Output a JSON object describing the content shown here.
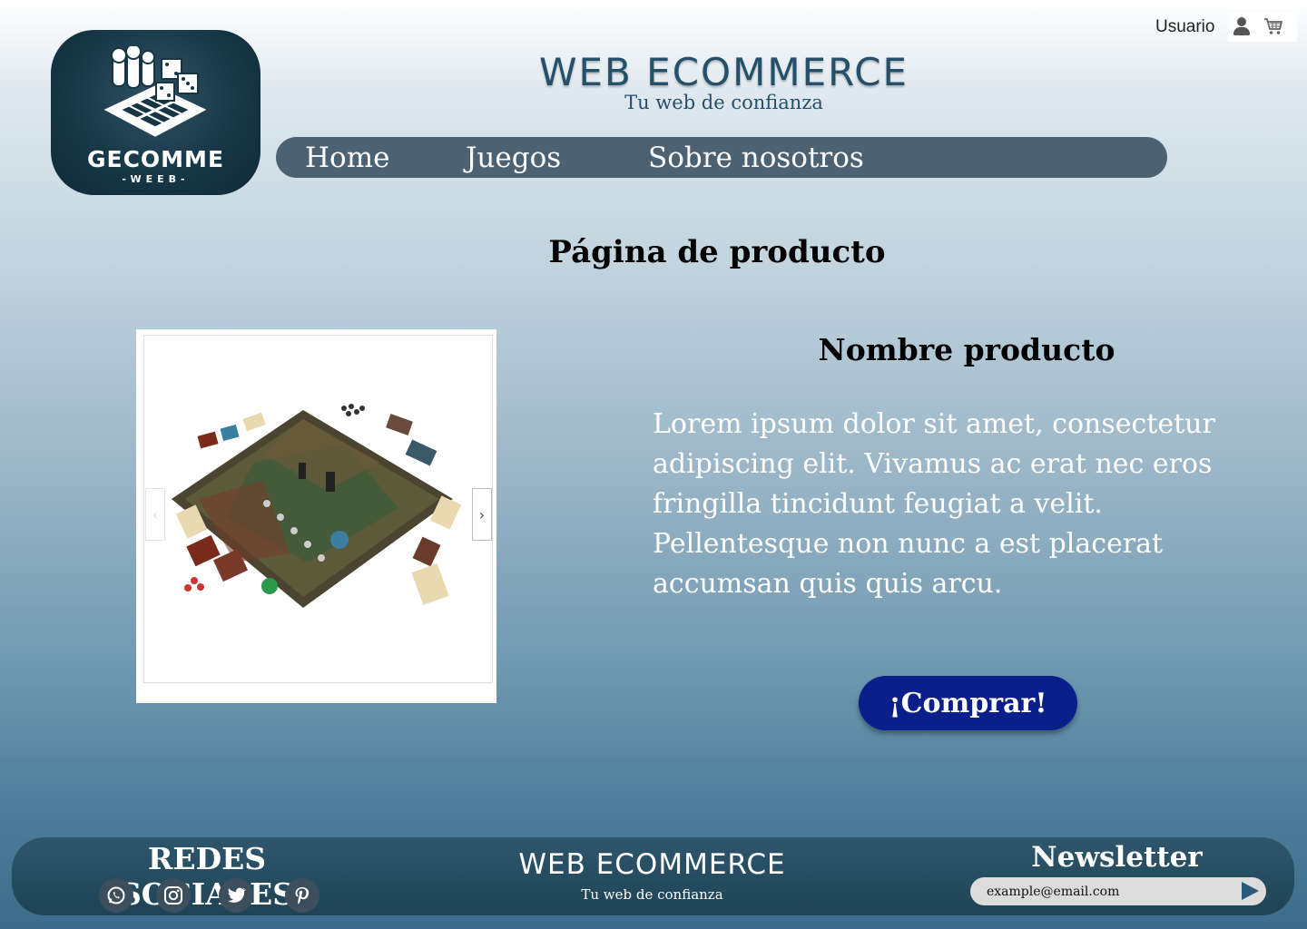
{
  "header": {
    "user_label": "Usuario",
    "title": "WEB ECOMMERCE",
    "tagline": "Tu web de confianza"
  },
  "logo": {
    "brand": "GECOMME",
    "sub": "-WEEB-"
  },
  "nav": {
    "items": [
      {
        "label": "Home"
      },
      {
        "label": "Juegos"
      },
      {
        "label": "Sobre nosotros"
      }
    ]
  },
  "main": {
    "heading": "Página de producto",
    "product_name": "Nombre producto",
    "description": "Lorem ipsum dolor sit amet, consectetur adipiscing elit. Vivamus ac erat nec eros fringilla tincidunt feugiat a velit. Pellentesque non nunc a est placerat accumsan quis quis arcu.",
    "buy_label": "¡Comprar!",
    "carousel_prev": "‹",
    "carousel_next": "›"
  },
  "footer": {
    "social_title": "REDES SOCIALES",
    "social_icons": [
      "whatsapp-icon",
      "instagram-icon",
      "twitter-icon",
      "pinterest-icon"
    ],
    "title": "WEB ECOMMERCE",
    "tagline": "Tu web de confianza",
    "newsletter_title": "Newsletter",
    "newsletter_value": "example@email.com"
  },
  "colors": {
    "nav_bg": "#4c6272",
    "buy_button": "#0a1f8a",
    "footer_bg": "#1e4355",
    "title_color": "#25506a"
  }
}
